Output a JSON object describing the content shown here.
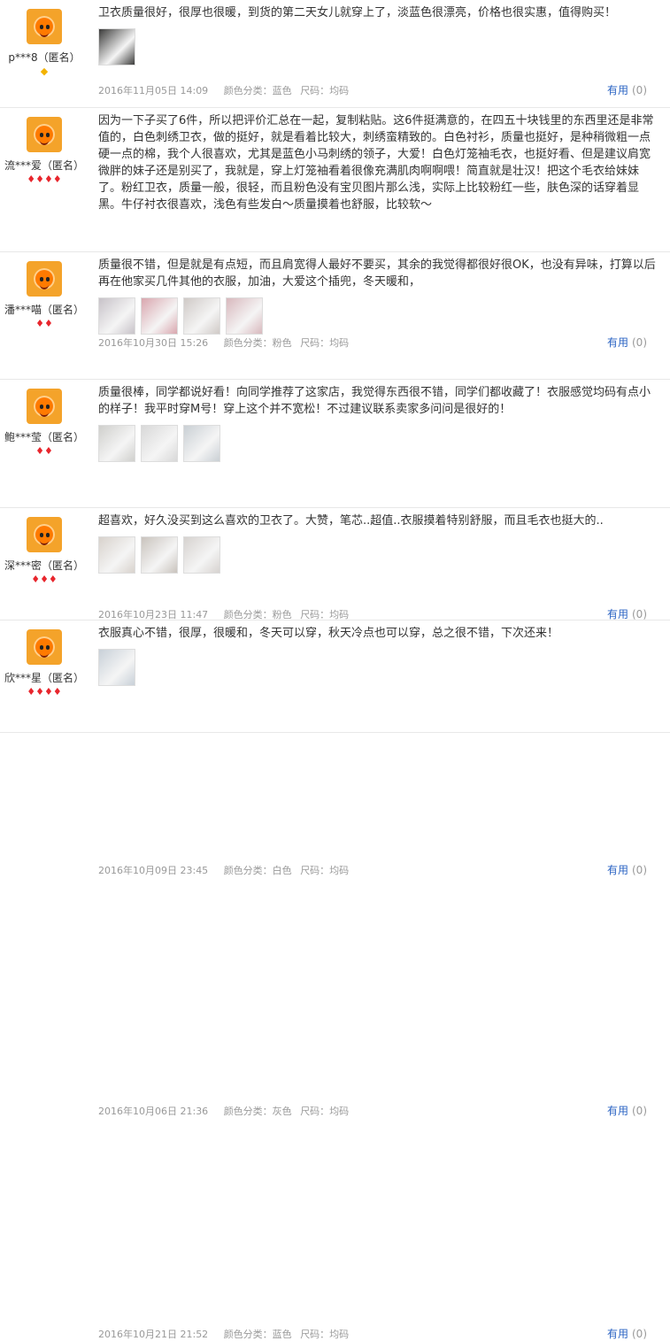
{
  "reviews": [
    {
      "user": "p***8（匿名）",
      "badge": "◆",
      "badge_color": "yellow",
      "text": "卫衣质量很好，很厚也很暖，到货的第二天女儿就穿上了，淡蓝色很漂亮，价格也很实惠，值得购买！",
      "photos": [
        "#3b3b3a"
      ],
      "date": "2016年11月05日 14:09",
      "color_label": "颜色分类：蓝色",
      "size_label": "尺码：均码",
      "useful_label": "有用",
      "useful_count": "(0)"
    },
    {
      "user": "流***爱（匿名）",
      "badge": "♦♦♦♦",
      "badge_color": "red",
      "text": "因为一下子买了6件，所以把评价汇总在一起，复制粘贴。这6件挺满意的，在四五十块钱里的东西里还是非常值的，白色刺绣卫衣，做的挺好，就是看着比较大，刺绣蛮精致的。白色衬衫，质量也挺好，是种稍微粗一点硬一点的棉，我个人很喜欢，尤其是蓝色小马刺绣的领子，大爱！白色灯笼袖毛衣，也挺好看、但是建议肩宽微胖的妹子还是别买了，我就是，穿上灯笼袖看着很像充满肌肉啊啊喂！简直就是壮汉！把这个毛衣给妹妹了。粉红卫衣，质量一般，很轻，而且粉色没有宝贝图片那么浅，实际上比较粉红一些，肤色深的话穿着显黑。牛仔衬衣很喜欢，浅色有些发白～质量摸着也舒服，比较软～",
      "photos": [],
      "date": "2016年10月30日 15:26",
      "color_label": "颜色分类：粉色",
      "size_label": "尺码：均码",
      "useful_label": "有用",
      "useful_count": "(0)"
    },
    {
      "user": "潘***喵（匿名）",
      "badge": "♦♦",
      "badge_color": "red",
      "text": "质量很不错，但是就是有点短，而且肩宽得人最好不要买，其余的我觉得都很好很OK，也没有异味，打算以后再在他家买几件其他的衣服，加油，大爱这个插兜，冬天暖和，",
      "photos": [
        "#c7c2c8",
        "#d9a6ae",
        "#cfc9c6",
        "#d8b8bd"
      ],
      "date": "2016年10月23日 11:47",
      "color_label": "颜色分类：粉色",
      "size_label": "尺码：均码",
      "useful_label": "有用",
      "useful_count": "(0)"
    },
    {
      "user": "鲍***莹（匿名）",
      "badge": "♦♦",
      "badge_color": "red",
      "text": "质量很棒，同学都说好看！向同学推荐了这家店，我觉得东西很不错，同学们都收藏了！衣服感觉均码有点小的样子！我平时穿M号！穿上这个并不宽松！不过建议联系卖家多问问是很好的！",
      "photos": [
        "#cfcfcc",
        "#d8d8d8",
        "#c9cfd4"
      ],
      "date": "2016年10月09日 23:45",
      "color_label": "颜色分类：白色",
      "size_label": "尺码：均码",
      "useful_label": "有用",
      "useful_count": "(0)"
    },
    {
      "user": "深***密（匿名）",
      "badge": "♦♦♦",
      "badge_color": "red",
      "text": "超喜欢，好久没买到这么喜欢的卫衣了。大赞，笔芯..超值..衣服摸着特别舒服，而且毛衣也挺大的..",
      "photos": [
        "#d8d2cc",
        "#c9c3bd",
        "#d6d2cf"
      ],
      "date": "2016年10月06日 21:36",
      "color_label": "颜色分类：灰色",
      "size_label": "尺码：均码",
      "useful_label": "有用",
      "useful_count": "(0)"
    },
    {
      "user": "欣***星（匿名）",
      "badge": "♦♦♦♦",
      "badge_color": "red",
      "text": "衣服真心不错，很厚，很暖和，冬天可以穿，秋天冷点也可以穿，总之很不错，下次还来！",
      "photos": [
        "#c8d0d8"
      ],
      "date": "2016年10月21日 21:52",
      "color_label": "颜色分类：蓝色",
      "size_label": "尺码：均码",
      "useful_label": "有用",
      "useful_count": "(0)"
    }
  ]
}
